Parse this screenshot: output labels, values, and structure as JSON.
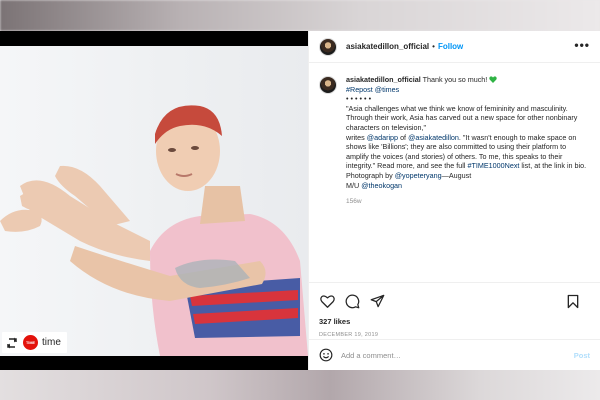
{
  "post": {
    "username": "asiakatedillon_official",
    "follow_label": "Follow",
    "separator": "•",
    "more_label": "•••"
  },
  "caption": {
    "username": "asiakatedillon_official",
    "line1": "Thank you so much!",
    "emoji": "green-heart",
    "repost_tag": "#Repost",
    "repost_mention": "@times",
    "dots": "• • • • • •",
    "quote_part1": "\"Asia challenges what we think we know of femininity and masculinity. Through their work, Asia has carved out a new space for other nonbinary characters on television,\"",
    "writes": "writes",
    "mention_adaripp": "@adaripp",
    "of": "of",
    "mention_asia": "@asiakatedillon",
    "quote_part2": ". \"It wasn't enough to make space on shows like 'Billions'; they are also committed to using their platform to amplify the voices (and stories) of others. To me, this speaks to their integrity.\" Read more, and see the full",
    "hashtag": "#TIME1000Next",
    "quote_part3": "list, at the link in bio. Photograph by",
    "mention_photographer": "@yopeteryang",
    "quote_part4": "—August",
    "mu": "M/U",
    "mention_mu": "@theokogan",
    "time_ago": "156w"
  },
  "actions": {
    "likes": "327 likes",
    "date": "DECEMBER 19, 2019"
  },
  "comment_box": {
    "placeholder": "Add a comment…",
    "post_label": "Post"
  },
  "repost_badge": {
    "logo_text": "TIME",
    "brand": "time"
  },
  "colors": {
    "link": "#00376b",
    "follow": "#0095f6",
    "post_disabled": "#b2dffc",
    "time_red": "#e3120b",
    "heart": "#2fb344"
  }
}
